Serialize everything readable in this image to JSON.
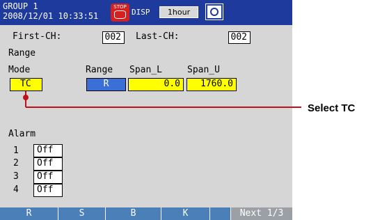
{
  "header": {
    "group": "GROUP 1",
    "datetime": "2008/12/01 10:33:51",
    "stop_label": "STOP",
    "disp_label": "DISP",
    "interval": "1hour"
  },
  "channels": {
    "first_label": "First-CH:",
    "first_value": "002",
    "last_label": "Last-CH:",
    "last_value": "002"
  },
  "range": {
    "section_title": "Range",
    "mode_label": "Mode",
    "mode_value": "TC",
    "range_label": "Range",
    "range_value": "R",
    "span_l_label": "Span_L",
    "span_l_value": "0.0",
    "span_u_label": "Span_U",
    "span_u_value": "1760.0"
  },
  "alarm": {
    "section_title": "Alarm",
    "rows": [
      {
        "num": "1",
        "value": "Off"
      },
      {
        "num": "2",
        "value": "Off"
      },
      {
        "num": "3",
        "value": "Off"
      },
      {
        "num": "4",
        "value": "Off"
      }
    ]
  },
  "softkeys": [
    "R",
    "S",
    "B",
    "K",
    "Next 1/3"
  ],
  "callout": "Select TC",
  "colors": {
    "header": "#1e3a9c",
    "screen": "#d6d6d6",
    "selected": "#ffff00",
    "range_box": "#3a6fd8",
    "callout_line": "#c0101a",
    "softkey_bar": "#4a7fb8"
  }
}
